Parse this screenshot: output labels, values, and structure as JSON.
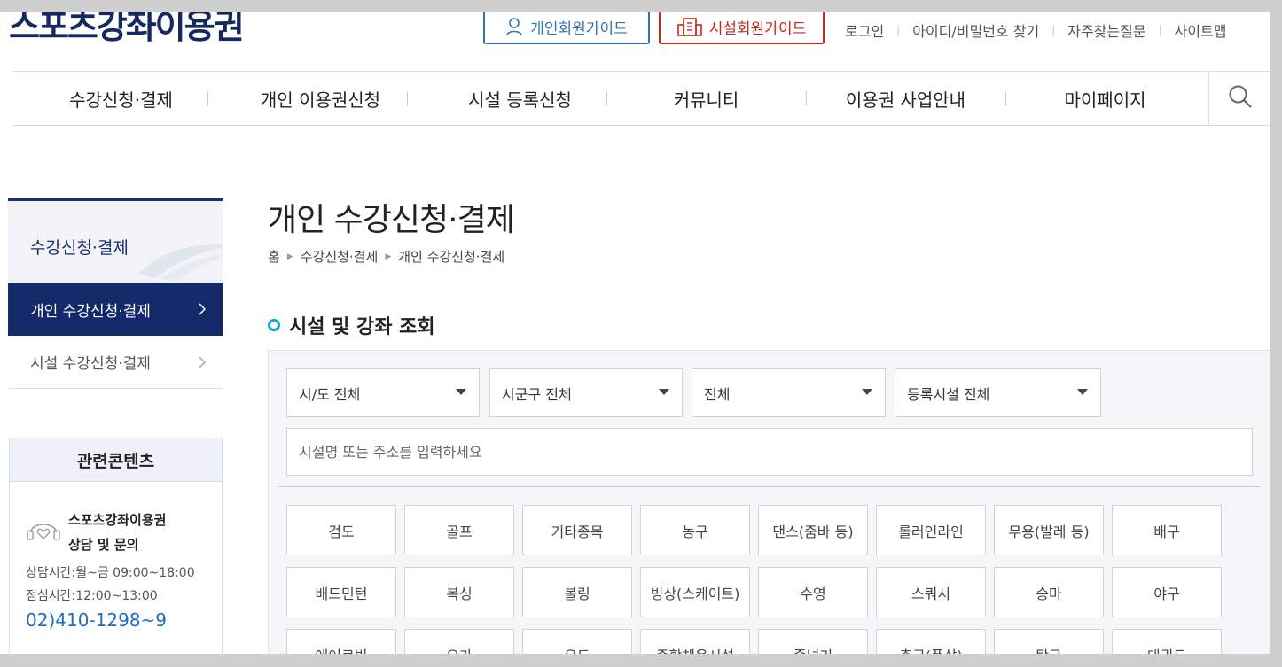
{
  "header": {
    "logo": "스포츠강좌이용권",
    "guide_personal": "개인회원가이드",
    "guide_facility": "시설회원가이드",
    "util_links": [
      "로그인",
      "아이디/비밀번호 찾기",
      "자주찾는질문",
      "사이트맵"
    ]
  },
  "gnb": {
    "items": [
      "수강신청·결제",
      "개인 이용권신청",
      "시설 등록신청",
      "커뮤니티",
      "이용권 사업안내",
      "마이페이지"
    ]
  },
  "sidebar": {
    "title": "수강신청·결제",
    "items": [
      {
        "label": "개인 수강신청·결제",
        "active": true
      },
      {
        "label": "시설 수강신청·결제",
        "active": false
      }
    ],
    "related": {
      "heading": "관련콘텐츠",
      "cs_title_line1": "스포츠강좌이용권",
      "cs_title_line2": "상담 및 문의",
      "hours": "상담시간:월~금 09:00~18:00",
      "lunch": "점심시간:12:00~13:00",
      "phone": "02)410-1298~9"
    }
  },
  "content": {
    "title": "개인 수강신청·결제",
    "breadcrumb": [
      "홈",
      "수강신청·결제",
      "개인 수강신청·결제"
    ],
    "section_title": "시설 및 강좌 조회",
    "selects": [
      "시/도 전체",
      "시군구 전체",
      "전체",
      "등록시설 전체"
    ],
    "search_placeholder": "시설명 또는 주소를 입력하세요",
    "categories": [
      "검도",
      "골프",
      "기타종목",
      "농구",
      "댄스(줌바 등)",
      "롤러인라인",
      "무용(발레 등)",
      "배구",
      "배드민턴",
      "복싱",
      "볼링",
      "빙상(스케이트)",
      "수영",
      "스쿼시",
      "승마",
      "야구",
      "에어로빅",
      "요가",
      "유도",
      "종합체육시설",
      "줄넘기",
      "축구(풋살)",
      "탁구",
      "태권도"
    ]
  },
  "colors": {
    "navy": "#14296a",
    "personal_blue": "#2f74b5",
    "facility_red": "#c8281e",
    "accent_cyan": "#1a9fd6",
    "phone_blue": "#1f6cc4"
  }
}
